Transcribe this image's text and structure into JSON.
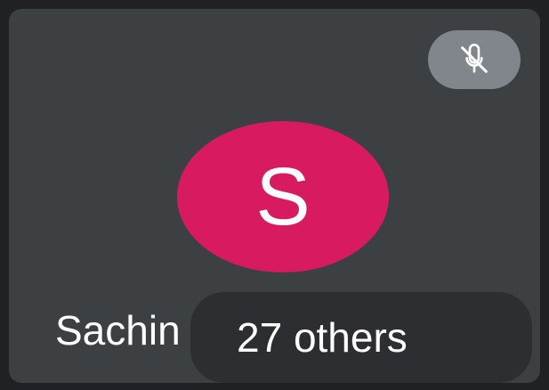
{
  "tile": {
    "participant_name": "Sachin",
    "avatar_initial": "S",
    "avatar_color": "#d81b60",
    "muted": true,
    "mute_icon": "mic-off-icon",
    "others_label": "27 others"
  },
  "colors": {
    "tile_background": "#3c4043",
    "mute_badge": "#80868b",
    "chip_background": "#2d2e31",
    "text": "#ffffff"
  }
}
